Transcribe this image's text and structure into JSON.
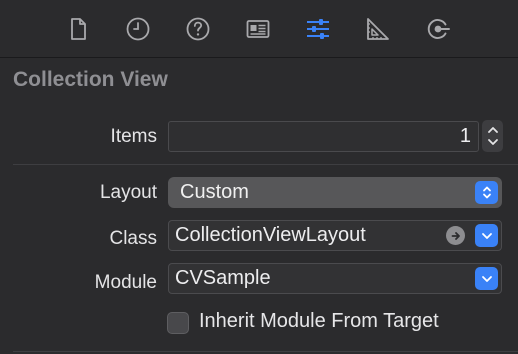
{
  "tabs": [
    {
      "name": "file-inspector",
      "icon": "document-icon",
      "active": false
    },
    {
      "name": "history-inspector",
      "icon": "clock-icon",
      "active": false
    },
    {
      "name": "quick-help",
      "icon": "question-circle-icon",
      "active": false
    },
    {
      "name": "identity-inspector",
      "icon": "id-card-icon",
      "active": false
    },
    {
      "name": "attributes-inspector",
      "icon": "sliders-icon",
      "active": true
    },
    {
      "name": "size-inspector",
      "icon": "ruler-triangle-icon",
      "active": false
    },
    {
      "name": "connections-inspector",
      "icon": "connection-arrow-icon",
      "active": false
    }
  ],
  "section": {
    "title": "Collection View"
  },
  "items": {
    "label": "Items",
    "value": "1"
  },
  "layout": {
    "label": "Layout",
    "value": "Custom"
  },
  "class": {
    "label": "Class",
    "value": "CollectionViewLayout"
  },
  "module": {
    "label": "Module",
    "value": "CVSample"
  },
  "inherit": {
    "label": "Inherit Module From Target",
    "checked": false
  },
  "colors": {
    "accent": "#3a82f7",
    "background": "#2b2b2d",
    "section_title": "#8f8f93"
  }
}
